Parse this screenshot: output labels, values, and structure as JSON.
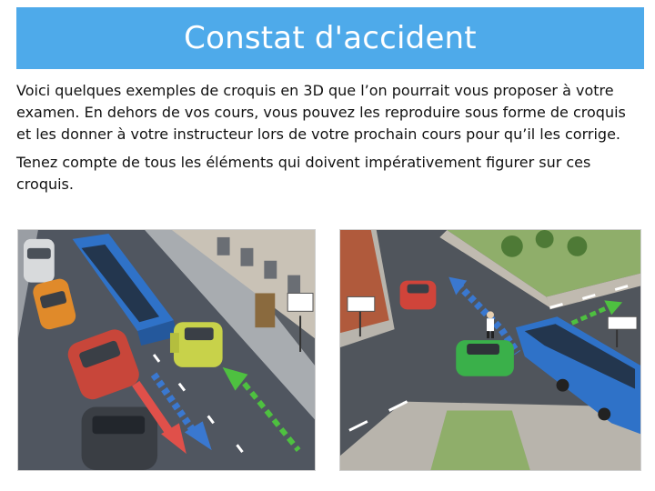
{
  "slide": {
    "title": "Constat d'accident",
    "paragraphs": [
      "Voici quelques exemples de croquis en 3D que l’on pourrait vous proposer à votre examen. En dehors de vos cours, vous pouvez les reproduire sous forme de croquis et les donner à votre instructeur lors de votre prochain cours pour qu’il les corrige.",
      "Tenez compte de tous les éléments qui doivent impérativement figurer sur ces croquis."
    ]
  },
  "colors": {
    "title_bar": "#4eaaea",
    "title_text": "#ffffff",
    "body_text": "#111111",
    "bus": "#2f72c8",
    "car_yellow": "#c8d24a",
    "car_orange": "#e07a2a",
    "car_red": "#c8463a",
    "car_green": "#3ab04a",
    "arrow_red": "#e0504a",
    "arrow_blue": "#3a78d0",
    "arrow_green": "#4ec040"
  },
  "images": [
    {
      "name": "accident-scene-bus-street",
      "icons": [
        "bus-icon",
        "car-icon",
        "arrow-icon",
        "street-sign-icon"
      ]
    },
    {
      "name": "accident-scene-intersection",
      "icons": [
        "bus-icon",
        "car-icon",
        "pedestrian-icon",
        "street-sign-icon"
      ]
    }
  ]
}
